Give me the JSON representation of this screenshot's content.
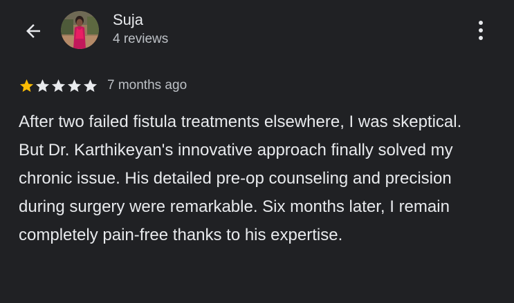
{
  "header": {
    "back_icon": "arrow-back-icon",
    "more_icon": "more-vert-icon"
  },
  "reviewer": {
    "name": "Suja",
    "review_count": "4 reviews",
    "avatar_icon": "user-avatar-photo"
  },
  "review": {
    "rating": 1,
    "max_rating": 5,
    "date": "7 months ago",
    "text": "After two failed fistula treatments elsewhere, I was skeptical. But Dr. Karthikeyan's innovative approach finally solved my chronic issue. His detailed pre-op counseling and precision during surgery were remarkable. Six months later, I remain completely pain-free thanks to his expertise."
  },
  "colors": {
    "background": "#202124",
    "text_primary": "#e8eaed",
    "text_secondary": "#bdc1c6",
    "star_filled": "#fbbc04",
    "star_empty": "#e8eaed"
  }
}
